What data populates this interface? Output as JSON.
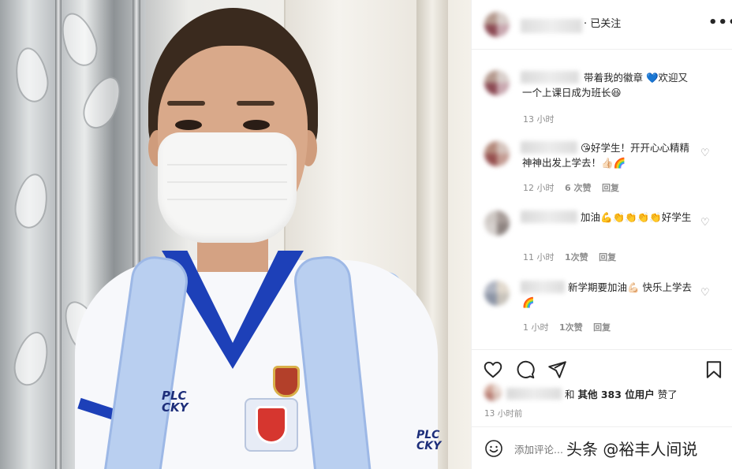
{
  "post": {
    "photo_alt": "",
    "jersey_text_left": "PLC\nCKY",
    "jersey_text_right": "PLC\nCKY"
  },
  "header": {
    "follow_status": "· 已关注",
    "more_icon": "ellipsis-icon"
  },
  "comments": [
    {
      "text": "带着我的徽章 💙欢迎又一个上课日成为班长😆",
      "time": "13 小时",
      "likes": "",
      "reply": ""
    },
    {
      "text": "😘好学生！开开心心精精神神出发上学去！👍🏻🌈",
      "time": "12 小时",
      "likes": "6 次赞",
      "reply": "回复"
    },
    {
      "text": "加油💪👏👏👏👏好学生",
      "time": "11 小时",
      "likes": "1次赞",
      "reply": "回复"
    },
    {
      "text": "新学期要加油💪🏻 快乐上学去🌈",
      "time": "1 小时",
      "likes": "1次赞",
      "reply": "回复"
    }
  ],
  "actions": {
    "like_icon": "heart-icon",
    "comment_icon": "comment-icon",
    "share_icon": "send-icon",
    "save_icon": "bookmark-icon"
  },
  "likes": {
    "conj": "和",
    "others": "其他 383 位用户",
    "suffix": "赞了"
  },
  "timestamp": "13 小时前",
  "composer": {
    "placeholder": "添加评论...",
    "smile_icon": "smile-icon"
  },
  "watermark": "头条 @裕丰人间说",
  "colors": {
    "text": "#262626",
    "muted": "#8e8e8e",
    "border": "#efefef",
    "jersey_blue": "#1d40b8"
  }
}
